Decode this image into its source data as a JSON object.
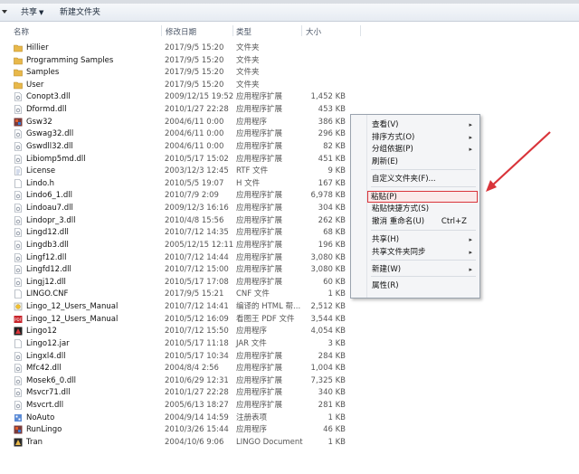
{
  "toolbar": {
    "share_label": "共享",
    "new_folder_label": "新建文件夹"
  },
  "columns": {
    "name": "名称",
    "date": "修改日期",
    "type": "类型",
    "size": "大小"
  },
  "files": [
    {
      "name": "Hillier",
      "date": "2017/9/5 15:20",
      "type": "文件夹",
      "size": "",
      "icon": "folder-icon"
    },
    {
      "name": "Programming Samples",
      "date": "2017/9/5 15:20",
      "type": "文件夹",
      "size": "",
      "icon": "folder-icon"
    },
    {
      "name": "Samples",
      "date": "2017/9/5 15:20",
      "type": "文件夹",
      "size": "",
      "icon": "folder-icon"
    },
    {
      "name": "User",
      "date": "2017/9/5 15:20",
      "type": "文件夹",
      "size": "",
      "icon": "folder-icon"
    },
    {
      "name": "Conopt3.dll",
      "date": "2009/12/15 19:52",
      "type": "应用程序扩展",
      "size": "1,452 KB",
      "icon": "dll-icon"
    },
    {
      "name": "Dformd.dll",
      "date": "2010/1/27 22:28",
      "type": "应用程序扩展",
      "size": "453 KB",
      "icon": "dll-icon"
    },
    {
      "name": "Gsw32",
      "date": "2004/6/11 0:00",
      "type": "应用程序",
      "size": "386 KB",
      "icon": "app-icon"
    },
    {
      "name": "Gswag32.dll",
      "date": "2004/6/11 0:00",
      "type": "应用程序扩展",
      "size": "296 KB",
      "icon": "dll-icon"
    },
    {
      "name": "Gswdll32.dll",
      "date": "2004/6/11 0:00",
      "type": "应用程序扩展",
      "size": "82 KB",
      "icon": "dll-icon"
    },
    {
      "name": "Libiomp5md.dll",
      "date": "2010/5/17 15:02",
      "type": "应用程序扩展",
      "size": "451 KB",
      "icon": "dll-icon"
    },
    {
      "name": "License",
      "date": "2003/12/3 12:45",
      "type": "RTF 文件",
      "size": "9 KB",
      "icon": "rtf-icon"
    },
    {
      "name": "Lindo.h",
      "date": "2010/5/5 19:07",
      "type": "H 文件",
      "size": "167 KB",
      "icon": "doc-icon"
    },
    {
      "name": "Lindo6_1.dll",
      "date": "2010/7/9 2:09",
      "type": "应用程序扩展",
      "size": "6,978 KB",
      "icon": "dll-icon"
    },
    {
      "name": "Lindoau7.dll",
      "date": "2009/12/3 16:16",
      "type": "应用程序扩展",
      "size": "304 KB",
      "icon": "dll-icon"
    },
    {
      "name": "Lindopr_3.dll",
      "date": "2010/4/8 15:56",
      "type": "应用程序扩展",
      "size": "262 KB",
      "icon": "dll-icon"
    },
    {
      "name": "Lingd12.dll",
      "date": "2010/7/12 14:35",
      "type": "应用程序扩展",
      "size": "68 KB",
      "icon": "dll-icon"
    },
    {
      "name": "Lingdb3.dll",
      "date": "2005/12/15 12:11",
      "type": "应用程序扩展",
      "size": "196 KB",
      "icon": "dll-icon"
    },
    {
      "name": "Lingf12.dll",
      "date": "2010/7/12 14:44",
      "type": "应用程序扩展",
      "size": "3,080 KB",
      "icon": "dll-icon"
    },
    {
      "name": "Lingfd12.dll",
      "date": "2010/7/12 15:00",
      "type": "应用程序扩展",
      "size": "3,080 KB",
      "icon": "dll-icon"
    },
    {
      "name": "Lingj12.dll",
      "date": "2010/5/17 17:08",
      "type": "应用程序扩展",
      "size": "60 KB",
      "icon": "dll-icon"
    },
    {
      "name": "LINGO.CNF",
      "date": "2017/9/5 15:21",
      "type": "CNF 文件",
      "size": "1 KB",
      "icon": "doc-icon"
    },
    {
      "name": "Lingo_12_Users_Manual",
      "date": "2010/7/12 14:41",
      "type": "编译的 HTML 帮...",
      "size": "2,512 KB",
      "icon": "chm-icon"
    },
    {
      "name": "Lingo_12_Users_Manual",
      "date": "2010/5/12 16:09",
      "type": "看图王 PDF 文件",
      "size": "3,544 KB",
      "icon": "pdf-icon"
    },
    {
      "name": "Lingo12",
      "date": "2010/7/12 15:50",
      "type": "应用程序",
      "size": "4,054 KB",
      "icon": "lingo-app-icon"
    },
    {
      "name": "Lingo12.jar",
      "date": "2010/5/17 11:18",
      "type": "JAR 文件",
      "size": "3 KB",
      "icon": "doc-icon"
    },
    {
      "name": "Lingxl4.dll",
      "date": "2010/5/17 10:34",
      "type": "应用程序扩展",
      "size": "284 KB",
      "icon": "dll-icon"
    },
    {
      "name": "Mfc42.dll",
      "date": "2004/8/4 2:56",
      "type": "应用程序扩展",
      "size": "1,004 KB",
      "icon": "dll-icon"
    },
    {
      "name": "Mosek6_0.dll",
      "date": "2010/6/29 12:31",
      "type": "应用程序扩展",
      "size": "7,325 KB",
      "icon": "dll-icon"
    },
    {
      "name": "Msvcr71.dll",
      "date": "2010/1/27 22:28",
      "type": "应用程序扩展",
      "size": "340 KB",
      "icon": "dll-icon"
    },
    {
      "name": "Msvcrt.dll",
      "date": "2005/6/13 18:27",
      "type": "应用程序扩展",
      "size": "281 KB",
      "icon": "dll-icon"
    },
    {
      "name": "NoAuto",
      "date": "2004/9/14 14:59",
      "type": "注册表项",
      "size": "1 KB",
      "icon": "reg-icon"
    },
    {
      "name": "RunLingo",
      "date": "2010/3/26 15:44",
      "type": "应用程序",
      "size": "46 KB",
      "icon": "app-icon"
    },
    {
      "name": "Tran",
      "date": "2004/10/6 9:06",
      "type": "LINGO Document",
      "size": "1 KB",
      "icon": "lingo-doc-icon"
    }
  ],
  "context_menu": {
    "items": [
      {
        "label": "查看(V)",
        "submenu": true,
        "shortcut": ""
      },
      {
        "label": "排序方式(O)",
        "submenu": true,
        "shortcut": ""
      },
      {
        "label": "分组依据(P)",
        "submenu": true,
        "shortcut": ""
      },
      {
        "label": "刷新(E)",
        "submenu": false,
        "shortcut": ""
      },
      {
        "label": "自定义文件夹(F)...",
        "submenu": false,
        "shortcut": ""
      },
      {
        "label": "粘贴(P)",
        "submenu": false,
        "shortcut": "",
        "highlighted": true
      },
      {
        "label": "粘贴快捷方式(S)",
        "submenu": false,
        "shortcut": ""
      },
      {
        "label": "撤消 重命名(U)",
        "submenu": false,
        "shortcut": "Ctrl+Z"
      },
      {
        "label": "共享(H)",
        "submenu": true,
        "shortcut": ""
      },
      {
        "label": "共享文件夹同步",
        "submenu": true,
        "shortcut": ""
      },
      {
        "label": "新建(W)",
        "submenu": true,
        "shortcut": ""
      },
      {
        "label": "属性(R)",
        "submenu": false,
        "shortcut": ""
      }
    ],
    "submenu_glyph": "▸"
  },
  "colors": {
    "annotation": "#d9343a",
    "folder": "#e8b84a"
  }
}
